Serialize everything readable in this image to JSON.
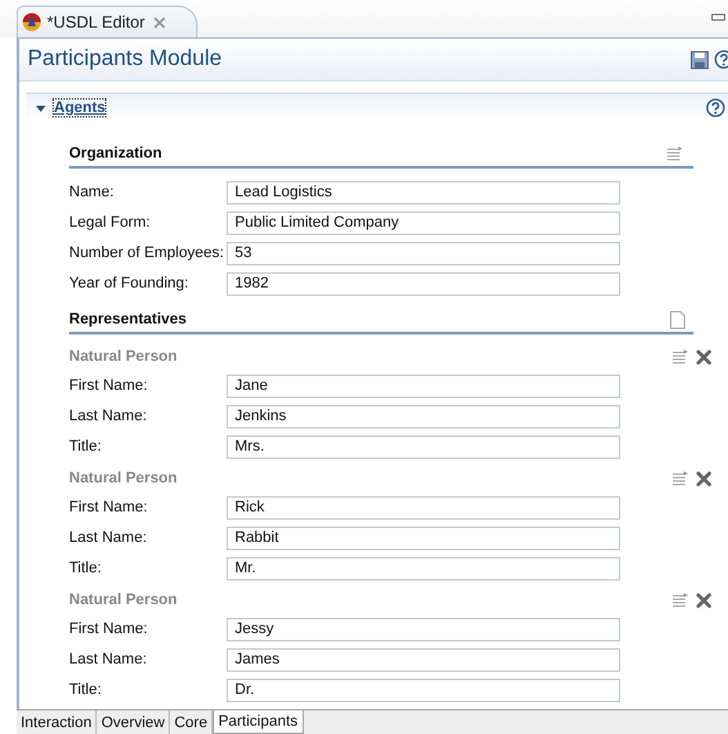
{
  "editor_tab": {
    "title": "*USDL Editor"
  },
  "form_title": "Participants Module",
  "section": {
    "title": "Agents",
    "expanded": true
  },
  "organization": {
    "title": "Organization",
    "fields": [
      {
        "label": "Name:",
        "value": "Lead Logistics"
      },
      {
        "label": "Legal Form:",
        "value": "Public Limited Company"
      },
      {
        "label": "Number of Employees:",
        "value": "53"
      },
      {
        "label": "Year of Founding:",
        "value": "1982"
      }
    ]
  },
  "representatives": {
    "title": "Representatives",
    "persons": [
      {
        "title": "Natural Person",
        "fields": [
          {
            "label": "First Name:",
            "value": "Jane"
          },
          {
            "label": "Last Name:",
            "value": "Jenkins"
          },
          {
            "label": "Title:",
            "value": "Mrs."
          }
        ]
      },
      {
        "title": "Natural Person",
        "fields": [
          {
            "label": "First Name:",
            "value": "Rick"
          },
          {
            "label": "Last Name:",
            "value": "Rabbit"
          },
          {
            "label": "Title:",
            "value": "Mr."
          }
        ]
      },
      {
        "title": "Natural Person",
        "fields": [
          {
            "label": "First Name:",
            "value": "Jessy"
          },
          {
            "label": "Last Name:",
            "value": "James"
          },
          {
            "label": "Title:",
            "value": "Dr."
          }
        ]
      }
    ]
  },
  "bottom_tabs": [
    {
      "label": "Interaction",
      "selected": false
    },
    {
      "label": "Overview",
      "selected": false
    },
    {
      "label": "Core",
      "selected": false
    },
    {
      "label": "Participants",
      "selected": true
    }
  ]
}
